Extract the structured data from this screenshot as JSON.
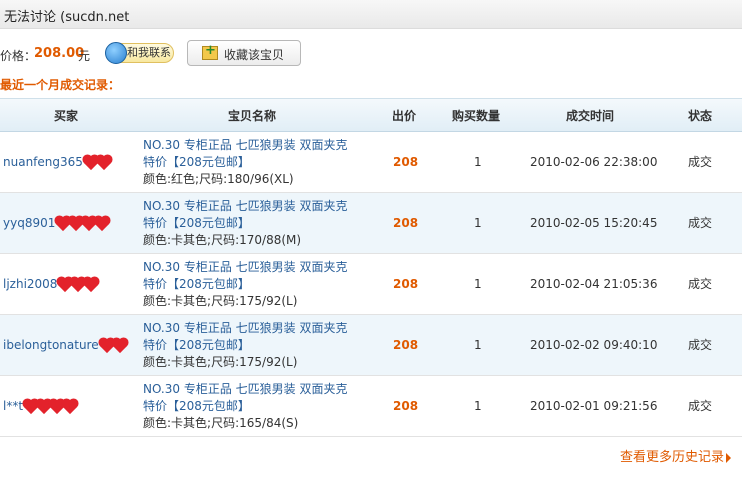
{
  "header": {
    "title": "无法讨论 (sucdn.net"
  },
  "price": {
    "label": "价格：",
    "value": "208.00",
    "unit": "元"
  },
  "buttons": {
    "contact": "和我联系",
    "favorite": "收藏该宝贝"
  },
  "section_title": "最近一个月成交记录：",
  "columns": [
    "买家",
    "宝贝名称",
    "出价",
    "购买数量",
    "成交时间",
    "状态"
  ],
  "rows": [
    {
      "buyer": "nuanfeng365",
      "hearts": 2,
      "line1": "NO.30 专柜正品 七匹狼男装 双面夹克",
      "line2": "特价【208元包邮】",
      "line3": "颜色:红色;尺码:180/96(XL)",
      "price": "208",
      "qty": "1",
      "time": "2010-02-06 22:38:00",
      "status": "成交"
    },
    {
      "buyer": "yyq8901",
      "hearts": 4,
      "line1": "NO.30 专柜正品 七匹狼男装 双面夹克",
      "line2": "特价【208元包邮】",
      "line3": "颜色:卡其色;尺码:170/88(M)",
      "price": "208",
      "qty": "1",
      "time": "2010-02-05 15:20:45",
      "status": "成交"
    },
    {
      "buyer": "ljzhi2008",
      "hearts": 3,
      "line1": "NO.30 专柜正品 七匹狼男装 双面夹克",
      "line2": "特价【208元包邮】",
      "line3": "颜色:卡其色;尺码:175/92(L)",
      "price": "208",
      "qty": "1",
      "time": "2010-02-04 21:05:36",
      "status": "成交"
    },
    {
      "buyer": "ibelongtonature",
      "hearts": 2,
      "line1": "NO.30 专柜正品 七匹狼男装 双面夹克",
      "line2": "特价【208元包邮】",
      "line3": "颜色:卡其色;尺码:175/92(L)",
      "price": "208",
      "qty": "1",
      "time": "2010-02-02 09:40:10",
      "status": "成交"
    },
    {
      "buyer": "l**t",
      "hearts": 4,
      "line1": "NO.30 专柜正品 七匹狼男装 双面夹克",
      "line2": "特价【208元包邮】",
      "line3": "颜色:卡其色;尺码:165/84(S)",
      "price": "208",
      "qty": "1",
      "time": "2010-02-01 09:21:56",
      "status": "成交"
    }
  ],
  "more_link": "查看更多历史记录",
  "icons": {
    "contact": "chat-bubble-icon",
    "favorite": "folder-plus-icon",
    "rating": "heart-icon",
    "more": "arrow-right-icon"
  },
  "colors": {
    "accent": "#e05a00",
    "link": "#2a5f99",
    "heart": "#e3222b",
    "header_bg": "#e1eef6",
    "alt_row": "#eef6fb"
  }
}
